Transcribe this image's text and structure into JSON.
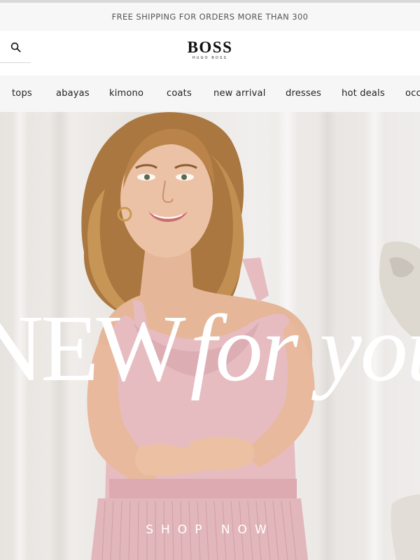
{
  "announcement": {
    "text": "FREE SHIPPING FOR ORDERS MORE THAN 300"
  },
  "header": {
    "logo_main": "BOSS",
    "logo_sub": "HUGO BOSS",
    "search_icon": "search-icon"
  },
  "nav": {
    "items": [
      {
        "label": "tops"
      },
      {
        "label": "abayas"
      },
      {
        "label": "kimono"
      },
      {
        "label": "coats"
      },
      {
        "label": "new arrival"
      },
      {
        "label": "dresses"
      },
      {
        "label": "hot deals"
      },
      {
        "label": "occ"
      }
    ]
  },
  "hero": {
    "headline_part1": "NEW",
    "headline_part2": "for you",
    "cta_label": "SHOP NOW",
    "colors": {
      "backdrop": "#ece9e6",
      "dress": "#e6bcc1",
      "fringe": "#e2b7bb",
      "hair": "#a9773f",
      "skin": "#e9bfa3",
      "text": "#ffffff"
    }
  }
}
